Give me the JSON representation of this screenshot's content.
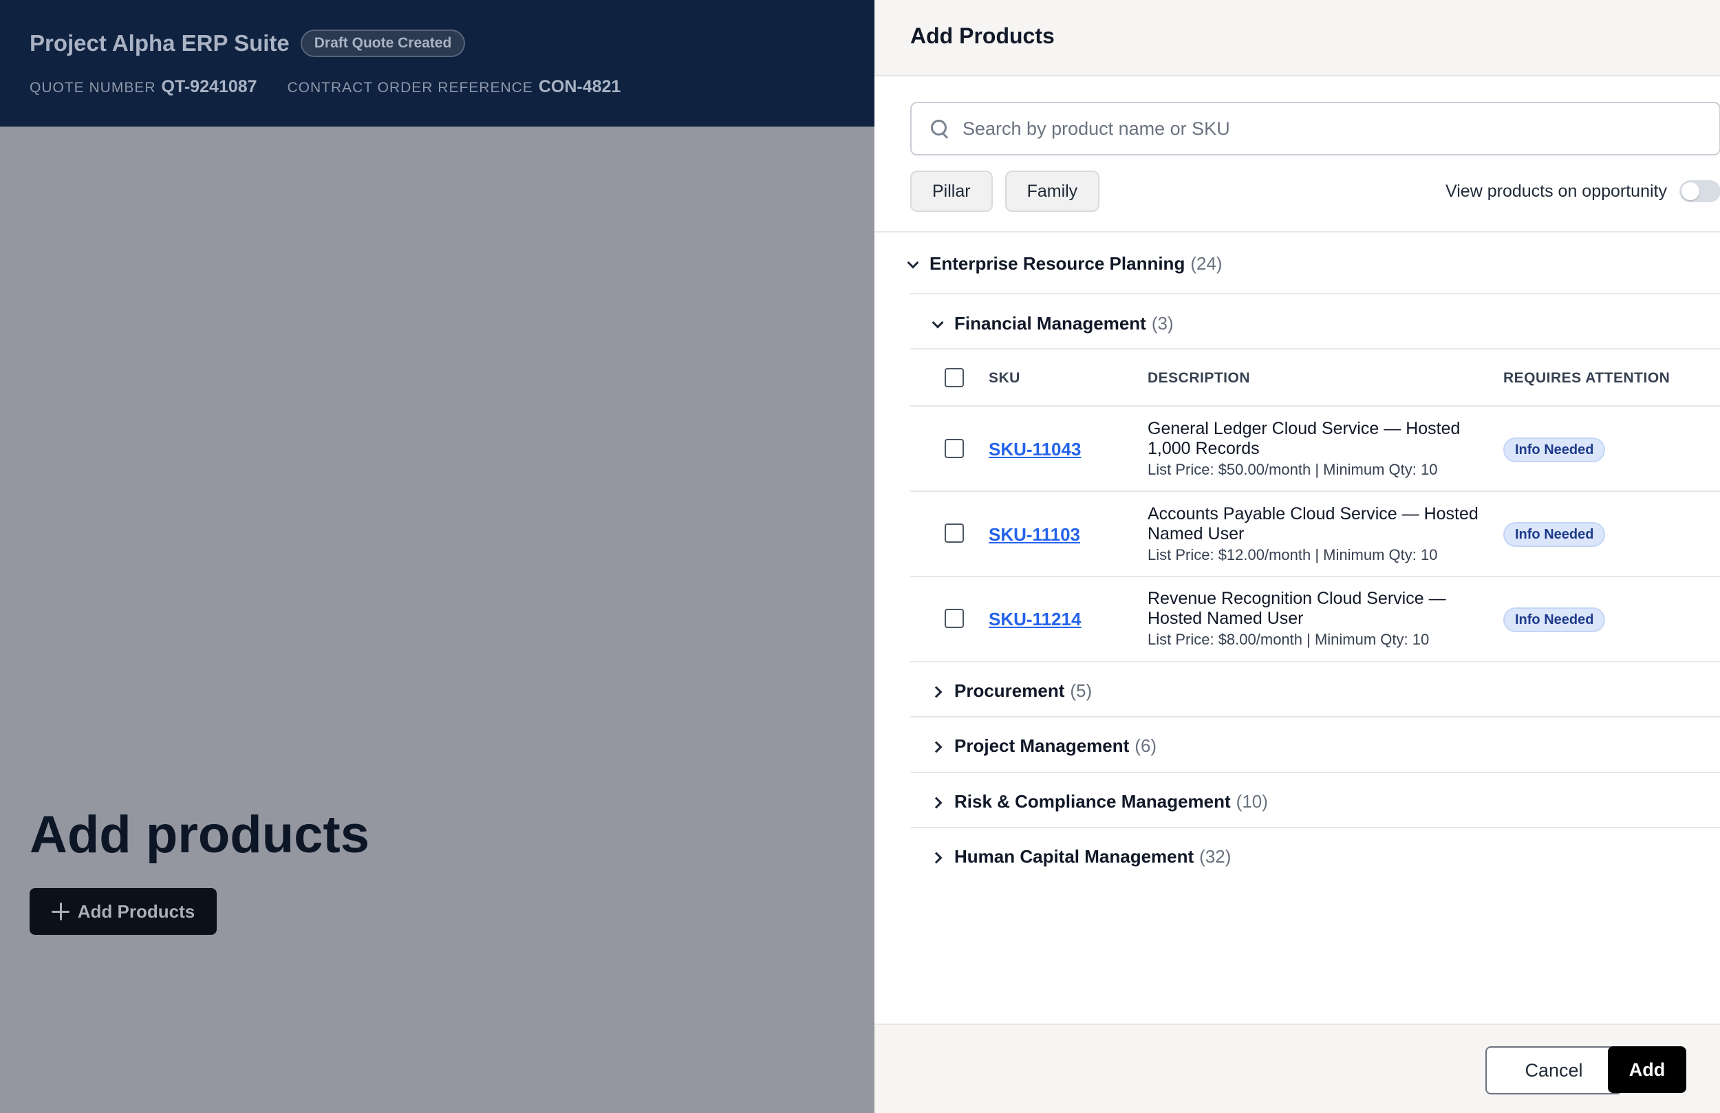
{
  "app": {
    "title": "Project Alpha ERP Suite",
    "status": "Draft Quote Created",
    "quote_label": "QUOTE NUMBER",
    "quote_value": "QT-9241087",
    "contract_label": "CONTRACT ORDER REFERENCE",
    "contract_value": "CON-4821",
    "heading": "Add products",
    "add_button_label": "Add Products"
  },
  "drawer": {
    "title": "Add Products",
    "search": {
      "placeholder": "Search by product name or SKU",
      "value": ""
    },
    "filters": [
      "Pillar",
      "Family"
    ],
    "toggle": {
      "label": "View products on opportunity",
      "on": false
    },
    "category": {
      "name": "Enterprise Resource Planning",
      "count": "(24)"
    },
    "subgroup": {
      "name": "Financial Management",
      "count": "(3)"
    },
    "columns": {
      "sku": "SKU",
      "description": "DESCRIPTION",
      "attention": "REQUIRES ATTENTION"
    },
    "rows": [
      {
        "sku": "SKU-11043",
        "title": "General Ledger Cloud Service — Hosted 1,000 Records",
        "price": "List Price: $50.00/month | Minimum Qty: 10",
        "attention": "Info Needed"
      },
      {
        "sku": "SKU-11103",
        "title": "Accounts Payable Cloud Service — Hosted Named User",
        "price": "List Price: $12.00/month | Minimum Qty: 10",
        "attention": "Info Needed"
      },
      {
        "sku": "SKU-11214",
        "title": "Revenue Recognition Cloud Service — Hosted Named User",
        "price": "List Price: $8.00/month | Minimum Qty: 10",
        "attention": "Info Needed"
      }
    ],
    "collapsed_groups": [
      {
        "name": "Procurement",
        "count": "(5)"
      },
      {
        "name": "Project Management",
        "count": "(6)"
      },
      {
        "name": "Risk & Compliance Management",
        "count": "(10)"
      },
      {
        "name": "Human Capital Management",
        "count": "(32)"
      }
    ],
    "footer": {
      "cancel_label": "Cancel",
      "add_label": "Add"
    }
  },
  "colors": {
    "header_bg": "#0f2240",
    "overlay": "#94979f",
    "link": "#2563eb",
    "badge_bg": "#dbe6fb",
    "primary": "#000000"
  }
}
